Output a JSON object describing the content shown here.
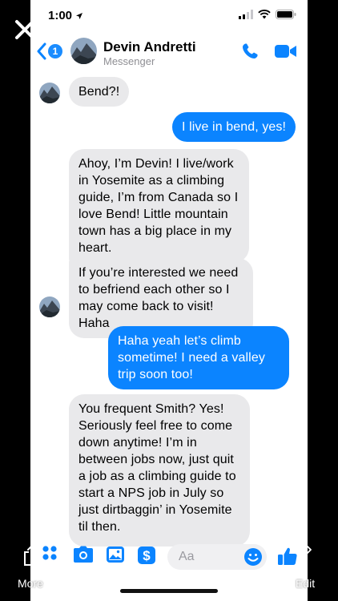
{
  "status_bar": {
    "time": "1:00"
  },
  "header": {
    "back_badge": "1",
    "contact_name": "Devin Andretti",
    "subtitle": "Messenger"
  },
  "messages": [
    {
      "from": "them",
      "text": "Bend?!"
    },
    {
      "from": "me",
      "text": "I live in bend, yes!"
    },
    {
      "from": "them",
      "text": "Ahoy, I’m Devin! I live/work in Yosemite as a climbing guide, I’m from Canada so I love Bend! Little mountain town has a big place in my heart."
    },
    {
      "from": "them",
      "text": "If you’re interested we need to befriend each other so I may come back to visit! Haha"
    },
    {
      "from": "me",
      "text": "Haha yeah let’s climb sometime! I need a valley trip soon too!"
    },
    {
      "from": "them",
      "text": "You frequent Smith? Yes! Seriously feel free to come down anytime! I’m in between jobs now, just quit a job as a climbing guide to start a NPS job in July so just dirtbaggin’ in Yosemite til then."
    }
  ],
  "composer": {
    "placeholder": "Aa"
  },
  "overlay": {
    "more_label": "More",
    "edit_label": "Edit"
  },
  "colors": {
    "accent": "#0b84ff",
    "incoming_bubble": "#e9e9eb"
  }
}
